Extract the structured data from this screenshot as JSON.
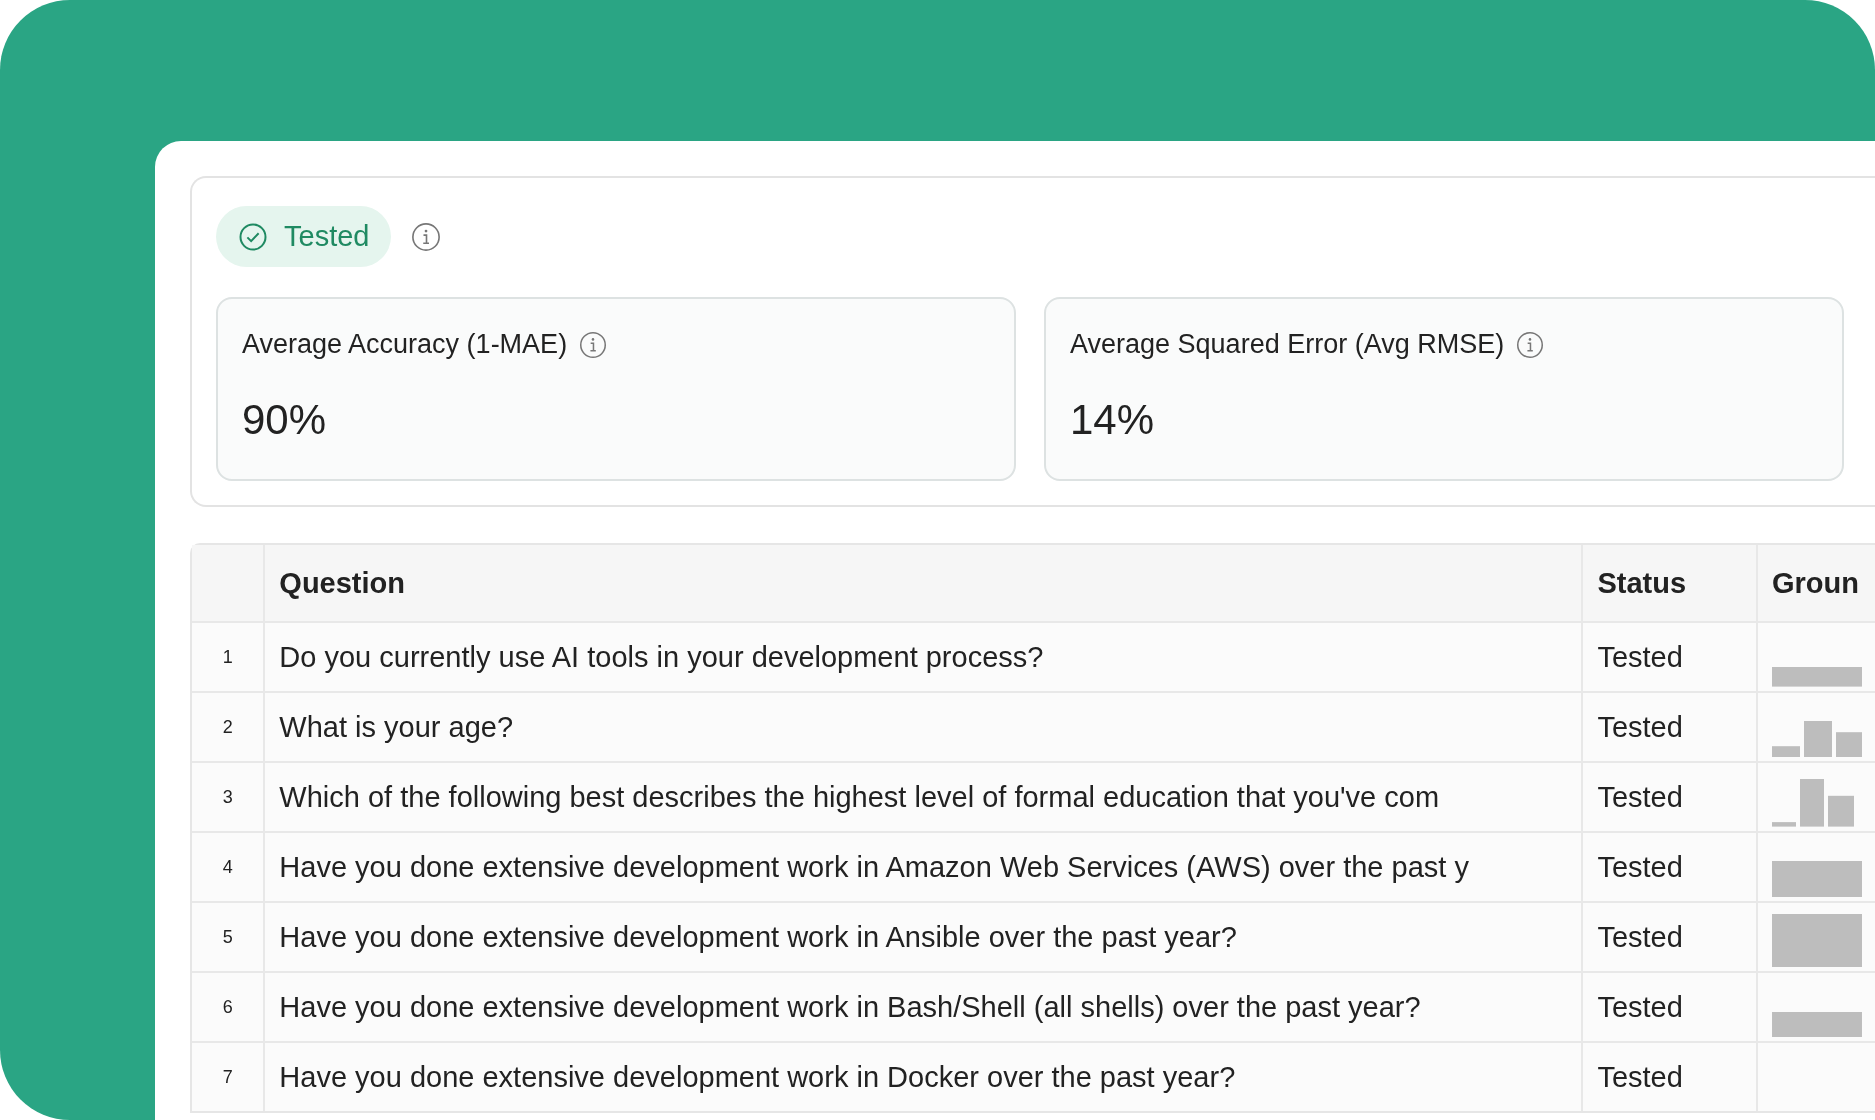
{
  "status_badge": {
    "label": "Tested"
  },
  "metrics": [
    {
      "label": "Average Accuracy (1-MAE)",
      "value": "90%"
    },
    {
      "label": "Average Squared Error (Avg RMSE)",
      "value": "14%"
    }
  ],
  "table": {
    "columns": [
      "Question",
      "Status",
      "Groun"
    ],
    "rows": [
      {
        "number": "1",
        "question": "Do you currently use AI tools in your development process?",
        "status": "Tested"
      },
      {
        "number": "2",
        "question": "What is your age?",
        "status": "Tested"
      },
      {
        "number": "3",
        "question": "Which of the following best describes the highest level of formal education that you've com",
        "status": "Tested"
      },
      {
        "number": "4",
        "question": "Have you done extensive development work in Amazon Web Services (AWS) over the past y",
        "status": "Tested"
      },
      {
        "number": "5",
        "question": "Have you done extensive development work in Ansible over the past year?",
        "status": "Tested"
      },
      {
        "number": "6",
        "question": "Have you done extensive development work in Bash/Shell (all shells) over the past year?",
        "status": "Tested"
      },
      {
        "number": "7",
        "question": "Have you done extensive development work in Docker over the past year?",
        "status": "Tested"
      }
    ]
  }
}
